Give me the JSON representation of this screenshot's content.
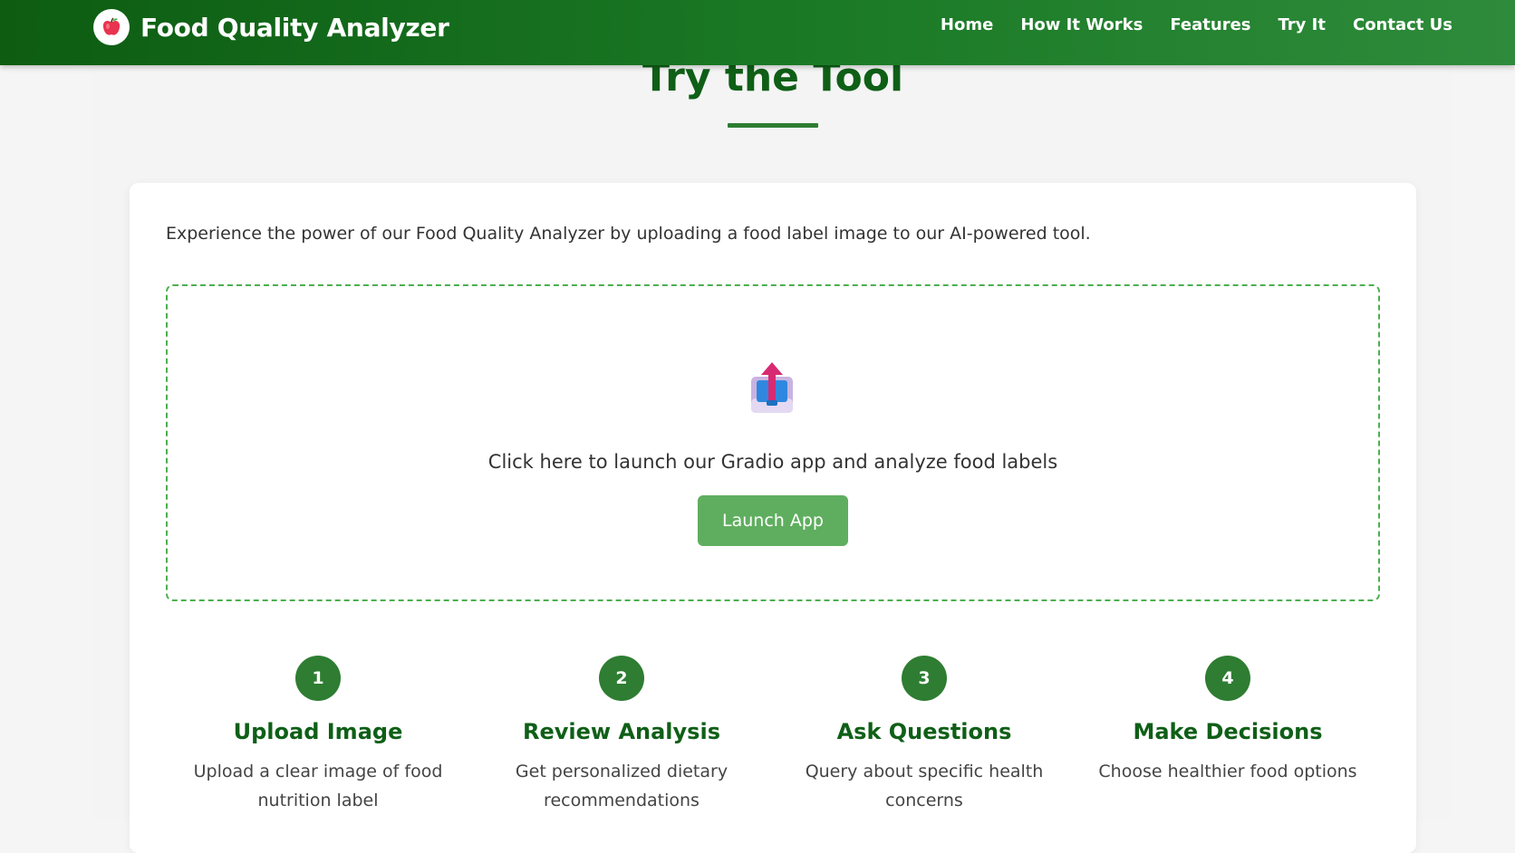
{
  "header": {
    "brand_title": "Food Quality Analyzer",
    "logo_icon": "apple-icon",
    "nav": [
      "Home",
      "How It Works",
      "Features",
      "Try It",
      "Contact Us"
    ]
  },
  "section": {
    "title": "Try the Tool",
    "intro": "Experience the power of our Food Quality Analyzer by uploading a food label image to our AI-powered tool.",
    "upload_icon": "upload-tray-icon",
    "upload_text": "Click here to launch our Gradio app and analyze food labels",
    "launch_label": "Launch App"
  },
  "steps": [
    {
      "num": "1",
      "title": "Upload Image",
      "desc": "Upload a clear image of food nutrition label"
    },
    {
      "num": "2",
      "title": "Review Analysis",
      "desc": "Get personalized dietary recommendations"
    },
    {
      "num": "3",
      "title": "Ask Questions",
      "desc": "Query about specific health concerns"
    },
    {
      "num": "4",
      "title": "Make Decisions",
      "desc": "Choose healthier food options"
    }
  ],
  "colors": {
    "primary": "#1b7a26",
    "accent": "#2e7d32",
    "button": "#5fae5f",
    "title": "#0f5f17"
  }
}
